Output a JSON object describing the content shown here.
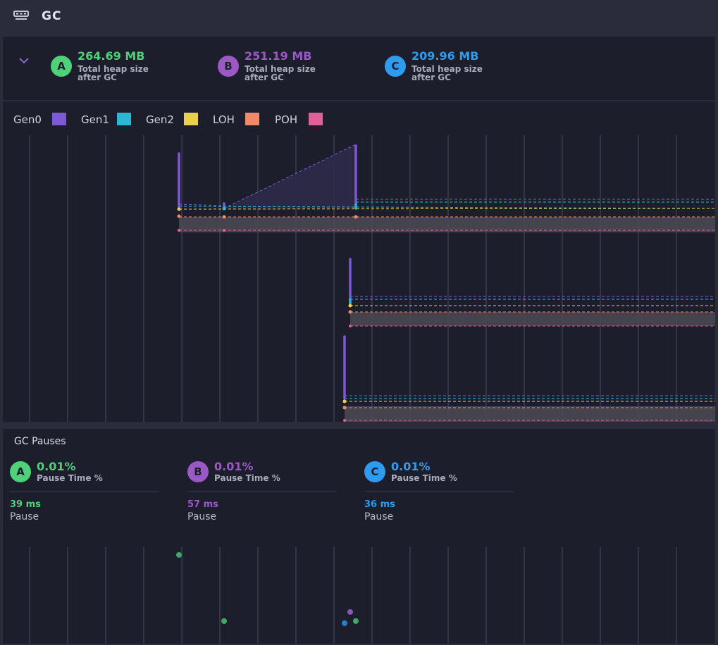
{
  "header": {
    "title": "GC"
  },
  "summary": {
    "items": [
      {
        "badge": "A",
        "value": "264.69 MB",
        "sub": "Total heap size after GC",
        "color": "#4fd17a"
      },
      {
        "badge": "B",
        "value": "251.19 MB",
        "sub": "Total heap size after GC",
        "color": "#9b59c6"
      },
      {
        "badge": "C",
        "value": "209.96 MB",
        "sub": "Total heap size after GC",
        "color": "#2f9bef"
      }
    ]
  },
  "legend": [
    {
      "label": "Gen0",
      "color": "#7c5ad6"
    },
    {
      "label": "Gen1",
      "color": "#2bb6d4"
    },
    {
      "label": "Gen2",
      "color": "#ecd04a"
    },
    {
      "label": "LOH",
      "color": "#f0896a"
    },
    {
      "label": "POH",
      "color": "#e0609a"
    }
  ],
  "pauses": {
    "title": "GC Pauses",
    "items": [
      {
        "badge": "A",
        "value": "0.01%",
        "sub": "Pause Time %",
        "ms": "39 ms",
        "label": "Pause",
        "color": "#4fd17a"
      },
      {
        "badge": "B",
        "value": "0.01%",
        "sub": "Pause Time %",
        "ms": "57 ms",
        "label": "Pause",
        "color": "#9b59c6"
      },
      {
        "badge": "C",
        "value": "0.01%",
        "sub": "Pause Time %",
        "ms": "36 ms",
        "label": "Pause",
        "color": "#2f9bef"
      }
    ]
  }
}
